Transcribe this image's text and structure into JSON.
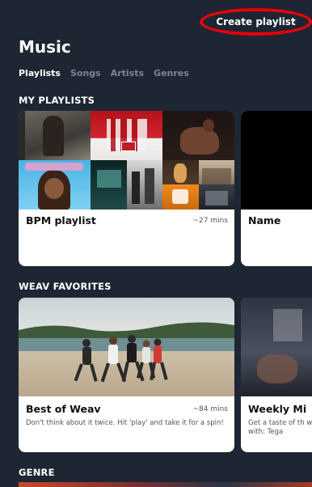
{
  "header": {
    "create_playlist_label": "Create playlist",
    "title": "Music"
  },
  "tabs": [
    {
      "label": "Playlists",
      "active": true
    },
    {
      "label": "Songs",
      "active": false
    },
    {
      "label": "Artists",
      "active": false
    },
    {
      "label": "Genres",
      "active": false
    }
  ],
  "sections": {
    "my_playlists": {
      "title": "MY PLAYLISTS",
      "cards": [
        {
          "title": "BPM playlist",
          "duration": "~27 mins"
        },
        {
          "title": "Name"
        }
      ]
    },
    "weav_favorites": {
      "title": "WEAV FAVORITES",
      "cards": [
        {
          "title": "Best of Weav",
          "duration": "~84 mins",
          "description": "Don't think about it twice. Hit 'play' and take it for a spin!"
        },
        {
          "title": "Weekly Mi",
          "description": "Get a taste of th week with: Tega"
        }
      ]
    },
    "genre": {
      "title": "GENRE"
    }
  },
  "colors": {
    "background": "#1e2633",
    "highlight_circle": "#e8000a",
    "inactive_tab": "#7b8596"
  }
}
